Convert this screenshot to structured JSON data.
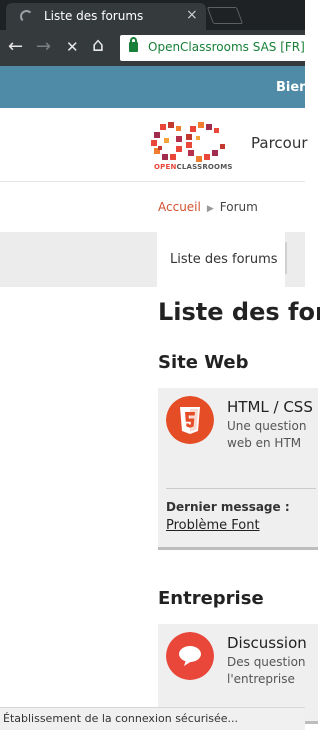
{
  "browser": {
    "tab_title": "Liste des forums",
    "tab_close": "×",
    "address_text": "OpenClassrooms SAS [FR]",
    "back_icon": "←",
    "forward_icon": "→",
    "stop_icon": "✕",
    "home_icon": "⌂",
    "status_text": "Établissement de la connexion sécurisée..."
  },
  "site": {
    "banner_text": "Bien",
    "logo_text_1": "OPEN",
    "logo_text_2": "CLASSROOMS",
    "nav_parcours": "Parcour"
  },
  "breadcrumb": {
    "home": "Accueil",
    "current": "Forum",
    "separator": "▶"
  },
  "tabs": {
    "active": "Liste des forums"
  },
  "page": {
    "title": "Liste des for"
  },
  "sections": [
    {
      "title": "Site Web",
      "card": {
        "name": "HTML / CSS",
        "desc_line1": "Une question",
        "desc_line2": "web en HTM",
        "last_label": "Dernier message :",
        "last_link": "Problème Font",
        "icon_color": "#e44d26"
      }
    },
    {
      "title": "Entreprise",
      "card": {
        "name": "Discussion",
        "desc_line1": "Des question",
        "desc_line2": "l'entreprise",
        "icon_color": "#e8473a"
      }
    }
  ],
  "colors": {
    "banner": "#4f8ba7",
    "accent": "#d2512f"
  }
}
